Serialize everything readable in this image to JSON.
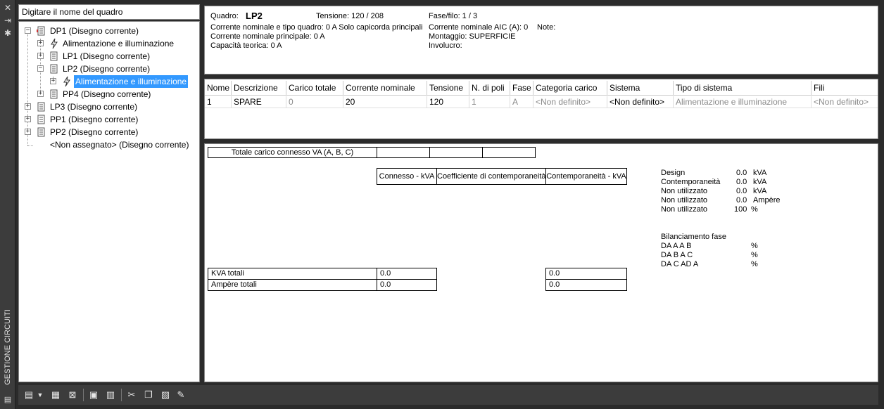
{
  "sidebar": {
    "title": "GESTIONE CIRCUITI",
    "close_icon": "close-icon",
    "pin_icon": "pin-icon",
    "settings_icon": "gear-icon"
  },
  "tree": {
    "search_placeholder": "Digitare il nome del quadro",
    "nodes": [
      {
        "label": "DP1 (Disegno corrente)",
        "expander": "−"
      },
      {
        "label": "Alimentazione e illuminazione",
        "expander": "+"
      },
      {
        "label": "LP1 (Disegno corrente)",
        "expander": "+"
      },
      {
        "label": "LP2 (Disegno corrente)",
        "expander": "−"
      },
      {
        "label": "Alimentazione e illuminazione",
        "expander": "+"
      },
      {
        "label": "PP4 (Disegno corrente)",
        "expander": "+"
      },
      {
        "label": "LP3 (Disegno corrente)",
        "expander": "+"
      },
      {
        "label": "PP1 (Disegno corrente)",
        "expander": "+"
      },
      {
        "label": "PP2 (Disegno corrente)",
        "expander": "+"
      },
      {
        "label": "<Non assegnato> (Disegno corrente)",
        "expander": ""
      }
    ]
  },
  "info": {
    "quadro_label": "Quadro:",
    "quadro_value": "LP2",
    "tensione": "Tensione: 120 / 208",
    "fase_filo": "Fase/filo:  1 /  3",
    "corrente_nominale_tipo": "Corrente nominale e tipo quadro: 0 A Solo capicorda principali",
    "corrente_aic": "Corrente nominale AIC (A):  0",
    "note": "Note:",
    "corrente_principale": "Corrente nominale principale: 0 A",
    "montaggio": "Montaggio:  SUPERFICIE",
    "capacita": "Capacità teorica: 0 A",
    "involucro": "Involucro:"
  },
  "grid": {
    "headers": [
      "Nome",
      "Descrizione",
      "Carico totale",
      "Corrente nominale",
      "Tensione",
      "N. di poli",
      "Fase",
      "Categoria carico",
      "Sistema",
      "Tipo di sistema",
      "Fili"
    ],
    "rows": [
      [
        "1",
        "SPARE",
        "0",
        "20",
        "120",
        "1",
        "A",
        "<Non definito>",
        "<Non definito>",
        "Alimentazione e illuminazione",
        "<Non definito>"
      ]
    ]
  },
  "summary": {
    "totale_carico": "Totale carico connesso VA (A, B, C)",
    "col_connesso": "Connesso - kVA",
    "col_coeff": "Coefficiente di contemporaneità",
    "col_contemp": "Contemporaneità - kVA",
    "kva_totali": "KVA totali",
    "ampere_totali": "Ampère totali",
    "kva_connesso": "0.0",
    "ampere_connesso": "0.0",
    "kva_contemp": "0.0",
    "ampere_contemp": "0.0",
    "right": [
      {
        "label": "Design",
        "value": "0.0",
        "unit": "kVA"
      },
      {
        "label": "Contemporaneità",
        "value": "0.0",
        "unit": "kVA"
      },
      {
        "label": "Non utilizzato",
        "value": "0.0",
        "unit": "kVA"
      },
      {
        "label": "Non utilizzato",
        "value": "0.0",
        "unit": "Ampère"
      },
      {
        "label": "Non utilizzato",
        "value": "100",
        "unit": "%"
      }
    ],
    "bilanciamento_title": "Bilanciamento fase",
    "bilanciamento": [
      {
        "label": "DA A A B",
        "unit": "%"
      },
      {
        "label": "DA B A C",
        "unit": "%"
      },
      {
        "label": "DA C AD A",
        "unit": "%"
      }
    ]
  },
  "toolbar": {
    "icons": [
      "new-panel-icon",
      "dropdown-arrow-icon",
      "new-circuit-icon",
      "delete-circuit-icon",
      "copy-panel-icon",
      "paste-panel-icon",
      "cut-icon",
      "copy-icon",
      "paste-icon",
      "edit-icon"
    ]
  }
}
